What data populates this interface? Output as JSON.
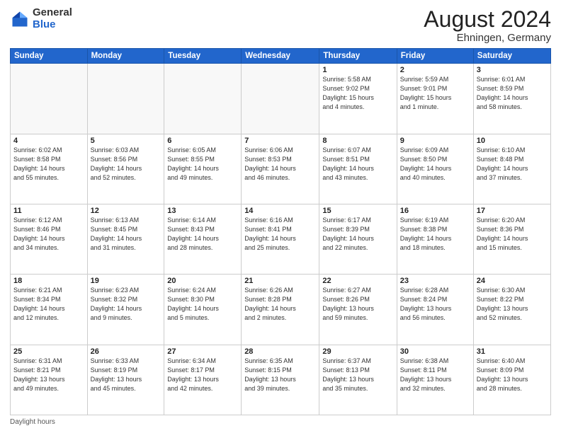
{
  "logo": {
    "general": "General",
    "blue": "Blue"
  },
  "header": {
    "month": "August 2024",
    "location": "Ehningen, Germany"
  },
  "weekdays": [
    "Sunday",
    "Monday",
    "Tuesday",
    "Wednesday",
    "Thursday",
    "Friday",
    "Saturday"
  ],
  "weeks": [
    [
      {
        "day": "",
        "info": ""
      },
      {
        "day": "",
        "info": ""
      },
      {
        "day": "",
        "info": ""
      },
      {
        "day": "",
        "info": ""
      },
      {
        "day": "1",
        "info": "Sunrise: 5:58 AM\nSunset: 9:02 PM\nDaylight: 15 hours\nand 4 minutes."
      },
      {
        "day": "2",
        "info": "Sunrise: 5:59 AM\nSunset: 9:01 PM\nDaylight: 15 hours\nand 1 minute."
      },
      {
        "day": "3",
        "info": "Sunrise: 6:01 AM\nSunset: 8:59 PM\nDaylight: 14 hours\nand 58 minutes."
      }
    ],
    [
      {
        "day": "4",
        "info": "Sunrise: 6:02 AM\nSunset: 8:58 PM\nDaylight: 14 hours\nand 55 minutes."
      },
      {
        "day": "5",
        "info": "Sunrise: 6:03 AM\nSunset: 8:56 PM\nDaylight: 14 hours\nand 52 minutes."
      },
      {
        "day": "6",
        "info": "Sunrise: 6:05 AM\nSunset: 8:55 PM\nDaylight: 14 hours\nand 49 minutes."
      },
      {
        "day": "7",
        "info": "Sunrise: 6:06 AM\nSunset: 8:53 PM\nDaylight: 14 hours\nand 46 minutes."
      },
      {
        "day": "8",
        "info": "Sunrise: 6:07 AM\nSunset: 8:51 PM\nDaylight: 14 hours\nand 43 minutes."
      },
      {
        "day": "9",
        "info": "Sunrise: 6:09 AM\nSunset: 8:50 PM\nDaylight: 14 hours\nand 40 minutes."
      },
      {
        "day": "10",
        "info": "Sunrise: 6:10 AM\nSunset: 8:48 PM\nDaylight: 14 hours\nand 37 minutes."
      }
    ],
    [
      {
        "day": "11",
        "info": "Sunrise: 6:12 AM\nSunset: 8:46 PM\nDaylight: 14 hours\nand 34 minutes."
      },
      {
        "day": "12",
        "info": "Sunrise: 6:13 AM\nSunset: 8:45 PM\nDaylight: 14 hours\nand 31 minutes."
      },
      {
        "day": "13",
        "info": "Sunrise: 6:14 AM\nSunset: 8:43 PM\nDaylight: 14 hours\nand 28 minutes."
      },
      {
        "day": "14",
        "info": "Sunrise: 6:16 AM\nSunset: 8:41 PM\nDaylight: 14 hours\nand 25 minutes."
      },
      {
        "day": "15",
        "info": "Sunrise: 6:17 AM\nSunset: 8:39 PM\nDaylight: 14 hours\nand 22 minutes."
      },
      {
        "day": "16",
        "info": "Sunrise: 6:19 AM\nSunset: 8:38 PM\nDaylight: 14 hours\nand 18 minutes."
      },
      {
        "day": "17",
        "info": "Sunrise: 6:20 AM\nSunset: 8:36 PM\nDaylight: 14 hours\nand 15 minutes."
      }
    ],
    [
      {
        "day": "18",
        "info": "Sunrise: 6:21 AM\nSunset: 8:34 PM\nDaylight: 14 hours\nand 12 minutes."
      },
      {
        "day": "19",
        "info": "Sunrise: 6:23 AM\nSunset: 8:32 PM\nDaylight: 14 hours\nand 9 minutes."
      },
      {
        "day": "20",
        "info": "Sunrise: 6:24 AM\nSunset: 8:30 PM\nDaylight: 14 hours\nand 5 minutes."
      },
      {
        "day": "21",
        "info": "Sunrise: 6:26 AM\nSunset: 8:28 PM\nDaylight: 14 hours\nand 2 minutes."
      },
      {
        "day": "22",
        "info": "Sunrise: 6:27 AM\nSunset: 8:26 PM\nDaylight: 13 hours\nand 59 minutes."
      },
      {
        "day": "23",
        "info": "Sunrise: 6:28 AM\nSunset: 8:24 PM\nDaylight: 13 hours\nand 56 minutes."
      },
      {
        "day": "24",
        "info": "Sunrise: 6:30 AM\nSunset: 8:22 PM\nDaylight: 13 hours\nand 52 minutes."
      }
    ],
    [
      {
        "day": "25",
        "info": "Sunrise: 6:31 AM\nSunset: 8:21 PM\nDaylight: 13 hours\nand 49 minutes."
      },
      {
        "day": "26",
        "info": "Sunrise: 6:33 AM\nSunset: 8:19 PM\nDaylight: 13 hours\nand 45 minutes."
      },
      {
        "day": "27",
        "info": "Sunrise: 6:34 AM\nSunset: 8:17 PM\nDaylight: 13 hours\nand 42 minutes."
      },
      {
        "day": "28",
        "info": "Sunrise: 6:35 AM\nSunset: 8:15 PM\nDaylight: 13 hours\nand 39 minutes."
      },
      {
        "day": "29",
        "info": "Sunrise: 6:37 AM\nSunset: 8:13 PM\nDaylight: 13 hours\nand 35 minutes."
      },
      {
        "day": "30",
        "info": "Sunrise: 6:38 AM\nSunset: 8:11 PM\nDaylight: 13 hours\nand 32 minutes."
      },
      {
        "day": "31",
        "info": "Sunrise: 6:40 AM\nSunset: 8:09 PM\nDaylight: 13 hours\nand 28 minutes."
      }
    ]
  ],
  "footer": {
    "note": "Daylight hours"
  }
}
